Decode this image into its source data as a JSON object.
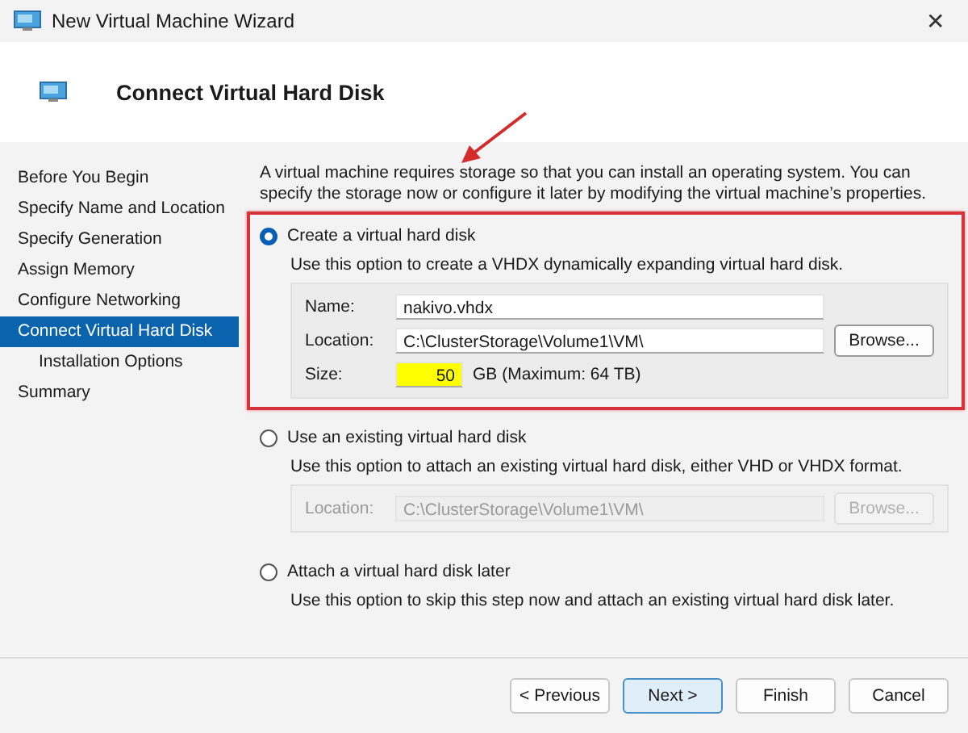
{
  "window": {
    "title": "New Virtual Machine Wizard",
    "close": "✕"
  },
  "header": {
    "title": "Connect Virtual Hard Disk"
  },
  "annotation_arrow": true,
  "steps": [
    {
      "label": "Before You Begin",
      "selected": false
    },
    {
      "label": "Specify Name and Location",
      "selected": false
    },
    {
      "label": "Specify Generation",
      "selected": false
    },
    {
      "label": "Assign Memory",
      "selected": false
    },
    {
      "label": "Configure Networking",
      "selected": false
    },
    {
      "label": "Connect Virtual Hard Disk",
      "selected": true,
      "children": [
        {
          "label": "Installation Options",
          "selected": false
        }
      ]
    },
    {
      "label": "Summary",
      "selected": false
    }
  ],
  "intro": "A virtual machine requires storage so that you can install an operating system. You can specify the storage now or configure it later by modifying the virtual machine’s properties.",
  "options": [
    {
      "label": "Create a virtual hard disk",
      "selected": true,
      "highlighted": true,
      "description": "Use this option to create a VHDX dynamically expanding virtual hard disk.",
      "fields": [
        {
          "kind": "text",
          "label": "Name:",
          "value": "nakivo.vhdx"
        },
        {
          "kind": "browse",
          "label": "Location:",
          "value": "C:\\ClusterStorage\\Volume1\\VM\\",
          "button": "Browse..."
        },
        {
          "kind": "size",
          "label": "Size:",
          "value": "50",
          "unit": "GB (Maximum: 64 TB)",
          "highlighted": true
        }
      ]
    },
    {
      "label": "Use an existing virtual hard disk",
      "selected": false,
      "highlighted": false,
      "description": "Use this option to attach an existing virtual hard disk, either VHD or VHDX format.",
      "disabled": true,
      "fields": [
        {
          "kind": "browse",
          "label": "Location:",
          "value": "C:\\ClusterStorage\\Volume1\\VM\\",
          "button": "Browse..."
        }
      ]
    },
    {
      "label": "Attach a virtual hard disk later",
      "selected": false,
      "highlighted": false,
      "description": "Use this option to skip this step now and attach an existing virtual hard disk later."
    }
  ],
  "buttons": [
    {
      "label": "< Previous",
      "default": false
    },
    {
      "label": "Next >",
      "default": true
    },
    {
      "label": "Finish",
      "default": false
    },
    {
      "label": "Cancel",
      "default": false
    }
  ]
}
